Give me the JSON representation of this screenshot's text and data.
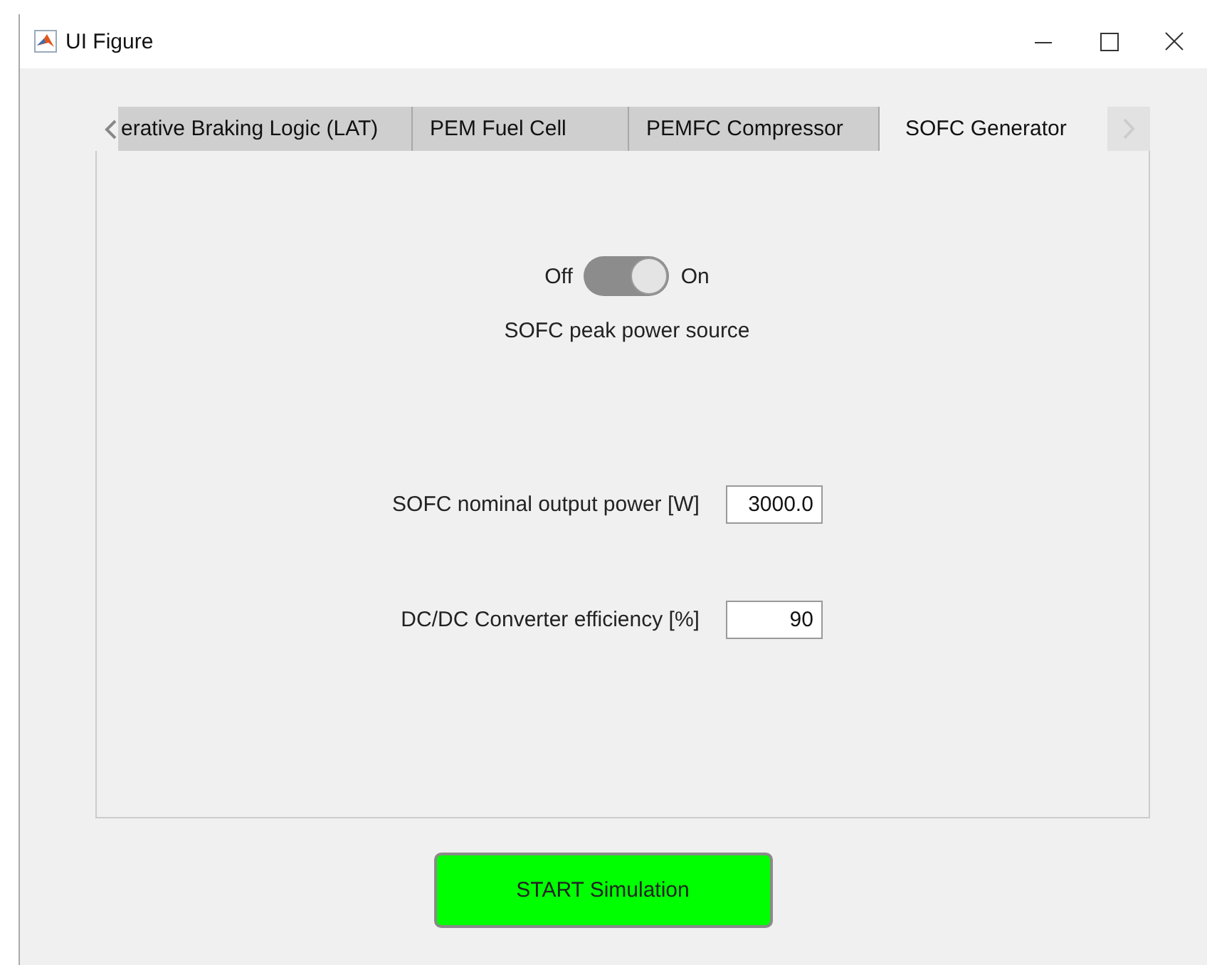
{
  "window": {
    "title": "UI Figure"
  },
  "tabs": [
    {
      "label": "erative Braking Logic (LAT)",
      "selected": false
    },
    {
      "label": "PEM Fuel Cell",
      "selected": false
    },
    {
      "label": "PEMFC Compressor",
      "selected": false
    },
    {
      "label": "SOFC Generator",
      "selected": true
    }
  ],
  "switch": {
    "off_label": "Off",
    "on_label": "On",
    "on": true,
    "caption": "SOFC peak power source"
  },
  "fields": [
    {
      "label": "SOFC nominal output power [W]",
      "value": "3000.0"
    },
    {
      "label": "DC/DC Converter efficiency [%]",
      "value": "90"
    }
  ],
  "button": {
    "label": "START Simulation"
  }
}
